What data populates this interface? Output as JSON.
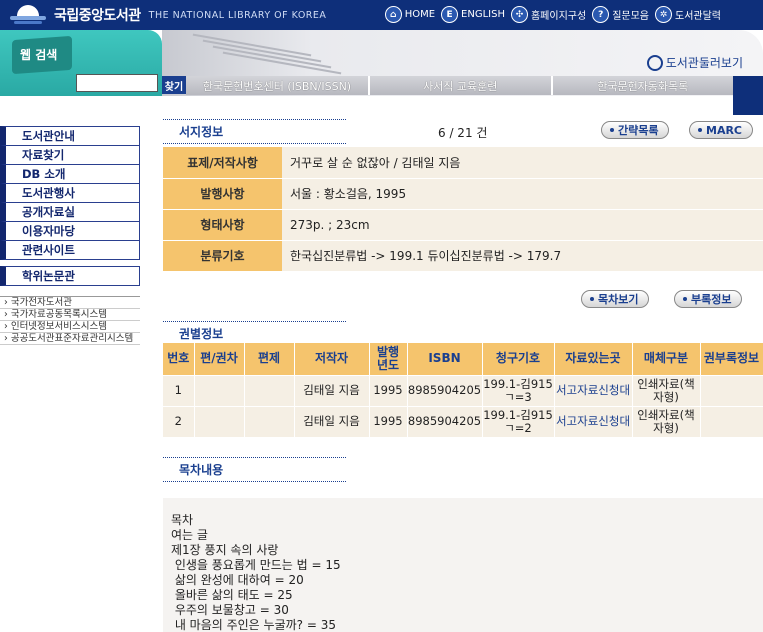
{
  "header": {
    "logo_kr": "국립중앙도서관",
    "logo_en": "THE NATIONAL LIBRARY OF KOREA",
    "nav": [
      {
        "label": "HOME",
        "glyph": "⌂"
      },
      {
        "label": "ENGLISH",
        "glyph": "E"
      },
      {
        "label": "홈페이지구성",
        "glyph": "✣"
      },
      {
        "label": "질문모음",
        "glyph": "?"
      },
      {
        "label": "도서관달력",
        "glyph": "✲"
      }
    ]
  },
  "banner": {
    "web_search_label": "웹 검색",
    "search_value": "",
    "go_label": "찾기",
    "stroll_label": "도서관둘러보기",
    "tabs": [
      "한국문헌번호센터 (ISBN/ISSN)",
      "사서직 교육훈련",
      "한국문헌자동화목록"
    ]
  },
  "sidebar": {
    "items": [
      "도서관안내",
      "자료찾기",
      "DB 소개",
      "도서관행사",
      "공개자료실",
      "이용자마당",
      "관련사이트"
    ],
    "special": "학위논문관",
    "sub_items": [
      "국가전자도서관",
      "국가자료공동목록시스템",
      "인터넷정보서비스시스템",
      "공공도서관표준자료관리시스템"
    ]
  },
  "biblio": {
    "section_title": "서지정보",
    "count": "6 / 21 건",
    "brief_button": "간략목록",
    "marc_button": "MARC",
    "rows": [
      {
        "label": "표제/저작사항",
        "value": "거꾸로 살 순 없잖아 / 김태일 지음"
      },
      {
        "label": "발행사항",
        "value": "서울 : 황소걸음, 1995"
      },
      {
        "label": "형태사항",
        "value": "273p. ; 23cm"
      },
      {
        "label": "분류기호",
        "value": "한국십진분류법 -> 199.1 듀이십진분류법 -> 179.7"
      }
    ],
    "toc_button": "목차보기",
    "appendix_button": "부록정보"
  },
  "volumes": {
    "section_title": "권별정보",
    "headers": [
      "번호",
      "편/권차",
      "편제",
      "저작자",
      "발행년도",
      "ISBN",
      "청구기호",
      "자료있는곳",
      "매체구분",
      "권부록정보"
    ],
    "rows": [
      {
        "no": "1",
        "part": "",
        "title": "",
        "author": "김태일 지음",
        "year": "1995",
        "isbn": "8985904205",
        "call": "199.1-김915ㄱ=3",
        "location": "서고자료신청대",
        "media": "인쇄자료(책자형)",
        "appendix": ""
      },
      {
        "no": "2",
        "part": "",
        "title": "",
        "author": "김태일 지음",
        "year": "1995",
        "isbn": "8985904205",
        "call": "199.1-김915ㄱ=2",
        "location": "서고자료신청대",
        "media": "인쇄자료(책자형)",
        "appendix": ""
      }
    ]
  },
  "toc": {
    "section_title": "목차내용",
    "lines": [
      "목차",
      "여는 글",
      "제1장 풍지 속의 사랑",
      " 인생을 풍요롭게 만드는 법 = 15",
      " 삶의 완성에 대하여 = 20",
      " 올바른 삶의 태도 = 25",
      " 우주의 보물창고 = 30",
      " 내 마음의 주인은 누굴까? = 35"
    ]
  }
}
